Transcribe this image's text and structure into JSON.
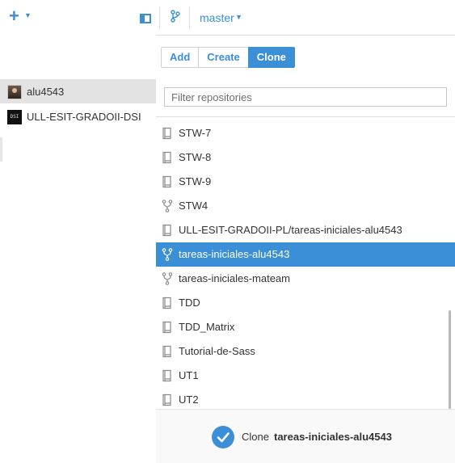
{
  "toolbar": {
    "add_icon": "plus-icon",
    "branch_name": "master",
    "colors": {
      "accent": "#3a8fd6"
    }
  },
  "sidebar": {
    "accounts": [
      {
        "label": "alu4543",
        "icon": "user-avatar",
        "selected": true
      },
      {
        "label": "ULL-ESIT-GRADOII-DSI",
        "icon": "org-avatar",
        "selected": false
      }
    ]
  },
  "main": {
    "tabs": [
      {
        "label": "Add",
        "active": false
      },
      {
        "label": "Create",
        "active": false
      },
      {
        "label": "Clone",
        "active": true
      }
    ],
    "filter_placeholder": "Filter repositories",
    "repos": [
      {
        "label": "STW-7",
        "icon": "repo-icon"
      },
      {
        "label": "STW-8",
        "icon": "repo-icon"
      },
      {
        "label": "STW-9",
        "icon": "repo-icon"
      },
      {
        "label": "STW4",
        "icon": "fork-icon"
      },
      {
        "label": "ULL-ESIT-GRADOII-PL/tareas-iniciales-alu4543",
        "icon": "repo-icon"
      },
      {
        "label": "tareas-iniciales-alu4543",
        "icon": "fork-icon",
        "selected": true
      },
      {
        "label": "tareas-iniciales-mateam",
        "icon": "fork-icon"
      },
      {
        "label": "TDD",
        "icon": "repo-icon"
      },
      {
        "label": "TDD_Matrix",
        "icon": "repo-icon"
      },
      {
        "label": "Tutorial-de-Sass",
        "icon": "repo-icon"
      },
      {
        "label": "UT1",
        "icon": "repo-icon"
      },
      {
        "label": "UT2",
        "icon": "repo-icon"
      }
    ],
    "footer": {
      "label": "Clone",
      "repo": "tareas-iniciales-alu4543"
    }
  }
}
